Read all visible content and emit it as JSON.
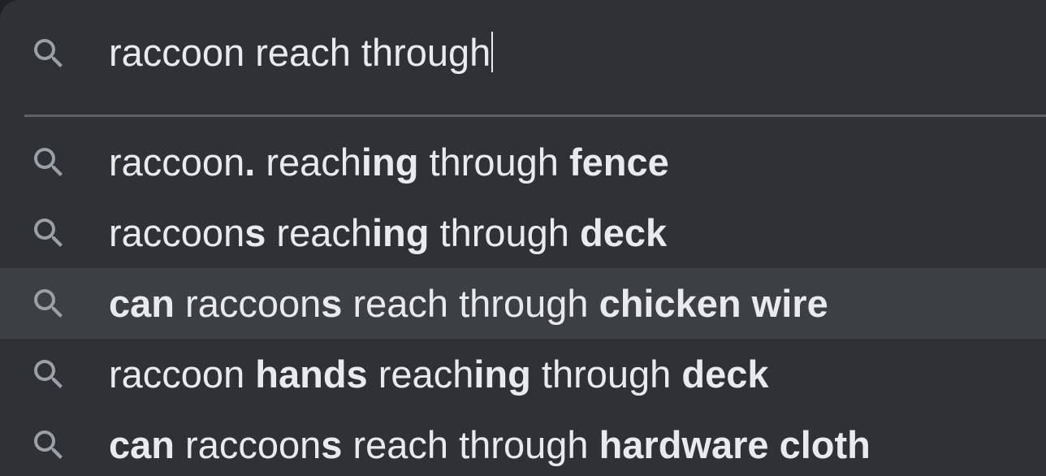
{
  "search": {
    "query": "raccoon reach through",
    "icon": "search-icon"
  },
  "colors": {
    "panel_background": "#303134",
    "highlight_background": "#3c4043",
    "text": "#e8eaed",
    "icon": "#9aa0a6",
    "divider": "#5f6368"
  },
  "suggestions": [
    {
      "icon": "search-icon",
      "highlighted": false,
      "segments": [
        {
          "text": "raccoon",
          "bold": false
        },
        {
          "text": ".",
          "bold": true
        },
        {
          "text": " reach",
          "bold": false
        },
        {
          "text": "ing",
          "bold": true
        },
        {
          "text": " through ",
          "bold": false
        },
        {
          "text": "fence",
          "bold": true
        }
      ]
    },
    {
      "icon": "search-icon",
      "highlighted": false,
      "segments": [
        {
          "text": "raccoon",
          "bold": false
        },
        {
          "text": "s",
          "bold": true
        },
        {
          "text": " reach",
          "bold": false
        },
        {
          "text": "ing",
          "bold": true
        },
        {
          "text": " through ",
          "bold": false
        },
        {
          "text": "deck",
          "bold": true
        }
      ]
    },
    {
      "icon": "search-icon",
      "highlighted": true,
      "segments": [
        {
          "text": "can",
          "bold": true
        },
        {
          "text": " raccoon",
          "bold": false
        },
        {
          "text": "s",
          "bold": true
        },
        {
          "text": " reach through ",
          "bold": false
        },
        {
          "text": "chicken wire",
          "bold": true
        }
      ]
    },
    {
      "icon": "search-icon",
      "highlighted": false,
      "segments": [
        {
          "text": "raccoon ",
          "bold": false
        },
        {
          "text": "hands",
          "bold": true
        },
        {
          "text": " reach",
          "bold": false
        },
        {
          "text": "ing",
          "bold": true
        },
        {
          "text": " through ",
          "bold": false
        },
        {
          "text": "deck",
          "bold": true
        }
      ]
    },
    {
      "icon": "search-icon",
      "highlighted": false,
      "segments": [
        {
          "text": "can",
          "bold": true
        },
        {
          "text": " raccoon",
          "bold": false
        },
        {
          "text": "s",
          "bold": true
        },
        {
          "text": " reach through ",
          "bold": false
        },
        {
          "text": "hardware cloth",
          "bold": true
        }
      ]
    }
  ]
}
